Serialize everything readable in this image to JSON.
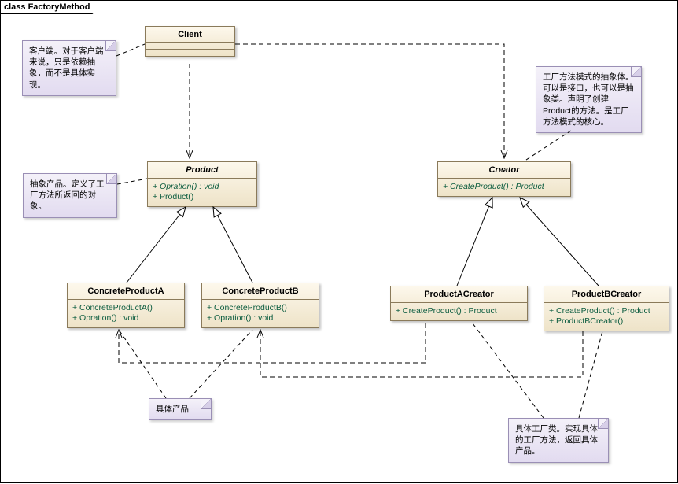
{
  "frame": {
    "label": "class FactoryMethod"
  },
  "classes": {
    "client": {
      "name": "Client"
    },
    "product": {
      "name": "Product",
      "ops": [
        "+   Opration() : void",
        "+   Product()"
      ]
    },
    "creator": {
      "name": "Creator",
      "ops": [
        "+   CreateProduct() : Product"
      ]
    },
    "concreteA": {
      "name": "ConcreteProductA",
      "ops": [
        "+   ConcreteProductA()",
        "+   Opration() : void"
      ]
    },
    "concreteB": {
      "name": "ConcreteProductB",
      "ops": [
        "+   ConcreteProductB()",
        "+   Opration() : void"
      ]
    },
    "prodACreator": {
      "name": "ProductACreator",
      "ops": [
        "+   CreateProduct() : Product"
      ]
    },
    "prodBCreator": {
      "name": "ProductBCreator",
      "ops": [
        "+   CreateProduct() : Product",
        "+   ProductBCreator()"
      ]
    }
  },
  "notes": {
    "clientNote": "客户端。对于客户端来说，只是依赖抽象，而不是具体实现。",
    "productNote": "抽象产品。定义了工厂方法所返回的对象。",
    "creatorNote": "工厂方法模式的抽象体。可以是接口，也可以是抽象类。声明了创建Product的方法。是工厂方法模式的核心。",
    "concreteNote": "具体产品",
    "concreteFactoryNote": "具体工厂类。实现具体的工厂方法，返回具体产品。"
  },
  "chart_data": {
    "type": "uml-class-diagram",
    "title": "FactoryMethod",
    "classes": [
      {
        "name": "Client",
        "abstract": false,
        "methods": []
      },
      {
        "name": "Product",
        "abstract": true,
        "methods": [
          "Opration() : void",
          "Product()"
        ]
      },
      {
        "name": "Creator",
        "abstract": true,
        "methods": [
          "CreateProduct() : Product"
        ]
      },
      {
        "name": "ConcreteProductA",
        "abstract": false,
        "methods": [
          "ConcreteProductA()",
          "Opration() : void"
        ]
      },
      {
        "name": "ConcreteProductB",
        "abstract": false,
        "methods": [
          "ConcreteProductB()",
          "Opration() : void"
        ]
      },
      {
        "name": "ProductACreator",
        "abstract": false,
        "methods": [
          "CreateProduct() : Product"
        ]
      },
      {
        "name": "ProductBCreator",
        "abstract": false,
        "methods": [
          "CreateProduct() : Product",
          "ProductBCreator()"
        ]
      }
    ],
    "relationships": [
      {
        "from": "Client",
        "to": "Product",
        "type": "dependency"
      },
      {
        "from": "Client",
        "to": "Creator",
        "type": "dependency"
      },
      {
        "from": "ConcreteProductA",
        "to": "Product",
        "type": "generalization"
      },
      {
        "from": "ConcreteProductB",
        "to": "Product",
        "type": "generalization"
      },
      {
        "from": "ProductACreator",
        "to": "Creator",
        "type": "generalization"
      },
      {
        "from": "ProductBCreator",
        "to": "Creator",
        "type": "generalization"
      },
      {
        "from": "ProductACreator",
        "to": "ConcreteProductA",
        "type": "dependency"
      },
      {
        "from": "ProductBCreator",
        "to": "ConcreteProductB",
        "type": "dependency"
      }
    ],
    "notes": [
      {
        "attachedTo": "Client",
        "text": "客户端。对于客户端来说，只是依赖抽象，而不是具体实现。"
      },
      {
        "attachedTo": "Product",
        "text": "抽象产品。定义了工厂方法所返回的对象。"
      },
      {
        "attachedTo": "Creator",
        "text": "工厂方法模式的抽象体。可以是接口，也可以是抽象类。声明了创建Product的方法。是工厂方法模式的核心。"
      },
      {
        "attachedTo": [
          "ConcreteProductA",
          "ConcreteProductB"
        ],
        "text": "具体产品"
      },
      {
        "attachedTo": [
          "ProductACreator",
          "ProductBCreator"
        ],
        "text": "具体工厂类。实现具体的工厂方法，返回具体产品。"
      }
    ]
  }
}
